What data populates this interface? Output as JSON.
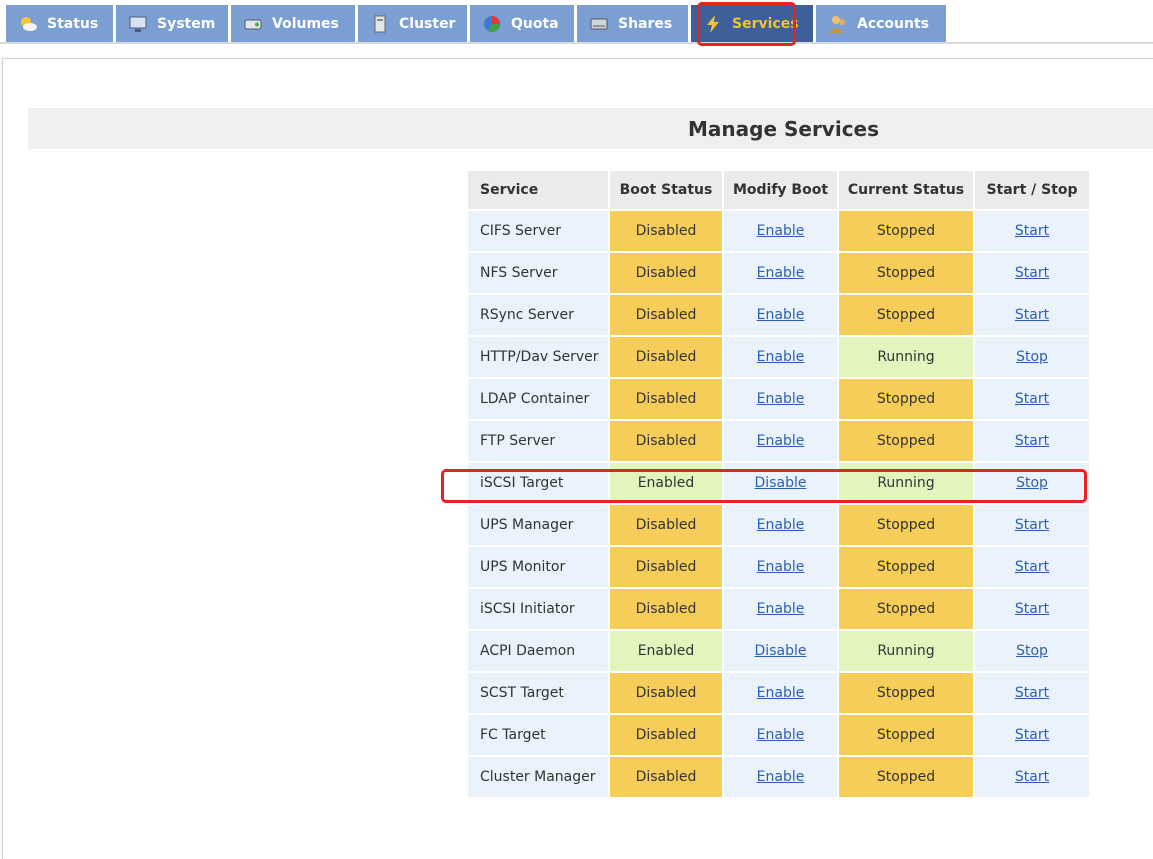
{
  "tabs": [
    {
      "label": "Status",
      "icon": "sun-cloud-icon",
      "active": false
    },
    {
      "label": "System",
      "icon": "computer-icon",
      "active": false
    },
    {
      "label": "Volumes",
      "icon": "disk-icon",
      "active": false
    },
    {
      "label": "Cluster",
      "icon": "server-icon",
      "active": false
    },
    {
      "label": "Quota",
      "icon": "pie-icon",
      "active": false
    },
    {
      "label": "Shares",
      "icon": "drive-icon",
      "active": false
    },
    {
      "label": "Services",
      "icon": "lightning-icon",
      "active": true
    },
    {
      "label": "Accounts",
      "icon": "users-icon",
      "active": false
    }
  ],
  "page": {
    "title": "Manage Services"
  },
  "table": {
    "headers": [
      "Service",
      "Boot Status",
      "Modify Boot",
      "Current Status",
      "Start / Stop"
    ],
    "rows": [
      {
        "service": "CIFS Server",
        "boot": "Disabled",
        "modify": "Enable",
        "current": "Stopped",
        "action": "Start"
      },
      {
        "service": "NFS Server",
        "boot": "Disabled",
        "modify": "Enable",
        "current": "Stopped",
        "action": "Start"
      },
      {
        "service": "RSync Server",
        "boot": "Disabled",
        "modify": "Enable",
        "current": "Stopped",
        "action": "Start"
      },
      {
        "service": "HTTP/Dav Server",
        "boot": "Disabled",
        "modify": "Enable",
        "current": "Running",
        "action": "Stop"
      },
      {
        "service": "LDAP Container",
        "boot": "Disabled",
        "modify": "Enable",
        "current": "Stopped",
        "action": "Start"
      },
      {
        "service": "FTP Server",
        "boot": "Disabled",
        "modify": "Enable",
        "current": "Stopped",
        "action": "Start"
      },
      {
        "service": "iSCSI Target",
        "boot": "Enabled",
        "modify": "Disable",
        "current": "Running",
        "action": "Stop"
      },
      {
        "service": "UPS Manager",
        "boot": "Disabled",
        "modify": "Enable",
        "current": "Stopped",
        "action": "Start"
      },
      {
        "service": "UPS Monitor",
        "boot": "Disabled",
        "modify": "Enable",
        "current": "Stopped",
        "action": "Start"
      },
      {
        "service": "iSCSI Initiator",
        "boot": "Disabled",
        "modify": "Enable",
        "current": "Stopped",
        "action": "Start"
      },
      {
        "service": "ACPI Daemon",
        "boot": "Enabled",
        "modify": "Disable",
        "current": "Running",
        "action": "Stop"
      },
      {
        "service": "SCST Target",
        "boot": "Disabled",
        "modify": "Enable",
        "current": "Stopped",
        "action": "Start"
      },
      {
        "service": "FC Target",
        "boot": "Disabled",
        "modify": "Enable",
        "current": "Stopped",
        "action": "Start"
      },
      {
        "service": "Cluster Manager",
        "boot": "Disabled",
        "modify": "Enable",
        "current": "Stopped",
        "action": "Start"
      }
    ]
  },
  "colors": {
    "tab_bg": "#7b9ed3",
    "tab_active_bg": "#3e5f97",
    "tab_active_text": "#f2c230",
    "status_warning": "#f7cd59",
    "status_ok": "#e2f5bd",
    "link": "#2b5fb6",
    "highlight": "#e8231e"
  }
}
